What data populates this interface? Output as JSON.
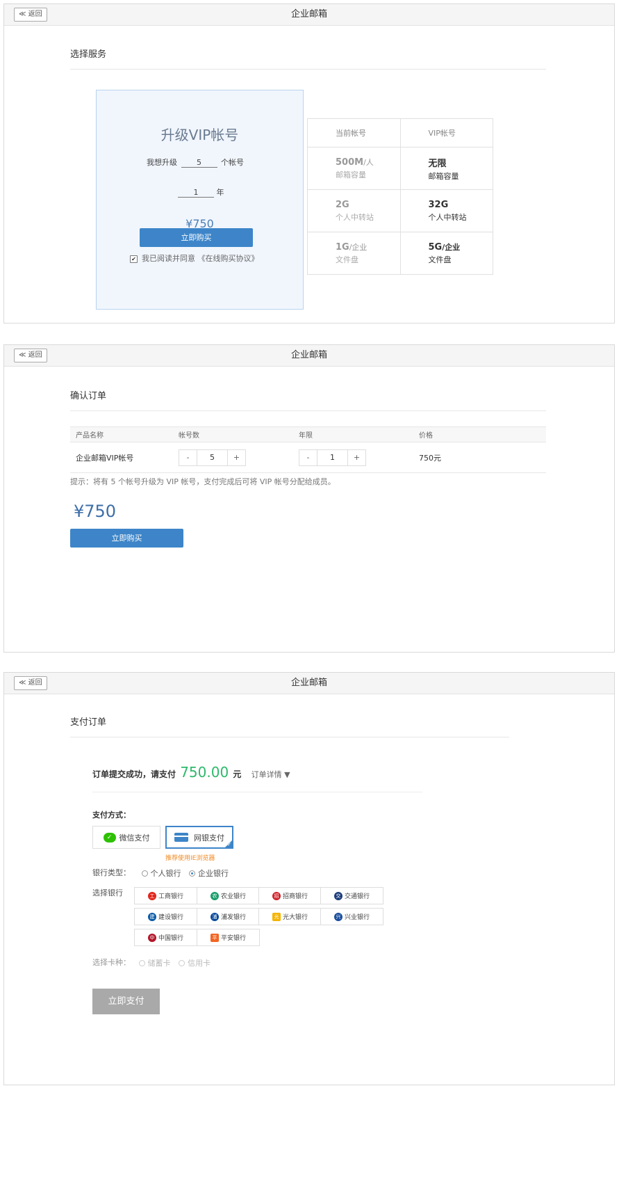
{
  "panels": [
    {
      "back_label": "≪ 返回",
      "title": "企业邮箱",
      "section_title": "选择服务"
    },
    {
      "back_label": "≪ 返回",
      "title": "企业邮箱",
      "section_title": "确认订单"
    },
    {
      "back_label": "≪ 返回",
      "title": "企业邮箱",
      "section_title": "支付订单"
    }
  ],
  "upgrade": {
    "title": "升级VIP帐号",
    "want_prefix": "我想升级",
    "account_count": "5",
    "want_suffix": "个帐号",
    "years": "1",
    "years_unit": "年",
    "price": "¥750",
    "buy_label": "立即购买",
    "agree_text": "我已阅读并同意 《在线购买协议》",
    "agree_checked": true
  },
  "compare": {
    "head": [
      "当前帐号",
      "VIP帐号"
    ],
    "rows": [
      {
        "cur_big": "500M",
        "cur_unit": "/人",
        "cur_sub": "邮箱容量",
        "vip_big": "无限",
        "vip_sub": "邮箱容量"
      },
      {
        "cur_big": "2G",
        "cur_unit": "",
        "cur_sub": "个人中转站",
        "vip_big": "32G",
        "vip_sub": "个人中转站"
      },
      {
        "cur_big": "1G",
        "cur_unit": "/企业",
        "cur_sub": "文件盘",
        "vip_big": "5G",
        "vip_unit": "/企业",
        "vip_sub": "文件盘"
      }
    ]
  },
  "order": {
    "columns": [
      "产品名称",
      "帐号数",
      "年限",
      "价格"
    ],
    "product": "企业邮箱VIP帐号",
    "minus": "-",
    "plus": "+",
    "accounts": "5",
    "years": "1",
    "price": "750元",
    "hint": "提示：将有 5 个帐号升级为 VIP 帐号，支付完成后可将 VIP 帐号分配给成员。",
    "total": "¥750",
    "buy_label": "立即购买"
  },
  "payment": {
    "success_prefix": "订单提交成功，请支付",
    "amount": "750.00",
    "currency": "元",
    "detail_label": "订单详情 ▼",
    "method_title": "支付方式：",
    "wechat_label": "微信支付",
    "bank_label": "网银支付",
    "ie_tip": "推荐使用IE浏览器",
    "bank_type_label": "银行类型：",
    "bank_type_personal": "个人银行",
    "bank_type_corporate": "企业银行",
    "select_bank_label": "选择银行",
    "banks": [
      {
        "name": "工商银行",
        "color": "#e1261c",
        "glyph": "工"
      },
      {
        "name": "农业银行",
        "color": "#199e6b",
        "glyph": "农"
      },
      {
        "name": "招商银行",
        "color": "#d0232b",
        "glyph": "招"
      },
      {
        "name": "交通银行",
        "color": "#1d3d7a",
        "glyph": "交"
      },
      {
        "name": "建设银行",
        "color": "#0b5aa7",
        "glyph": "建"
      },
      {
        "name": "浦发银行",
        "color": "#0b4a9c",
        "glyph": "浦"
      },
      {
        "name": "光大银行",
        "color": "#f4b400",
        "glyph": "光"
      },
      {
        "name": "兴业银行",
        "color": "#1b4e9c",
        "glyph": "兴"
      },
      {
        "name": "中国银行",
        "color": "#b3162a",
        "glyph": "中"
      },
      {
        "name": "平安银行",
        "color": "#f26522",
        "glyph": "平"
      }
    ],
    "card_type_label": "选择卡种：",
    "card_debit": "储蓄卡",
    "card_credit": "信用卡",
    "submit_label": "立即支付"
  }
}
